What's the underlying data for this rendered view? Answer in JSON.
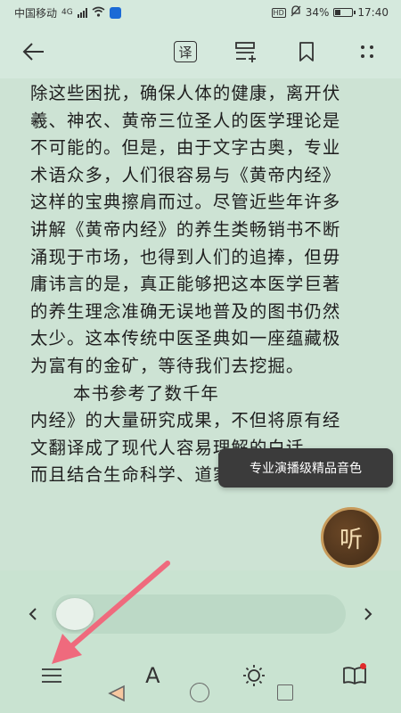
{
  "status_bar": {
    "carrier": "中国移动",
    "network": "4G",
    "battery_text": "34%",
    "battery_level": 0.34,
    "time": "17:40",
    "hd_label": "HD"
  },
  "toolbar": {
    "translate_label": "译"
  },
  "reader": {
    "lines": [
      "除这些困扰，确保人体的健康，离开伏",
      "羲、神农、黄帝三位圣人的医学理论是",
      "不可能的。但是，由于文字古奥，专业",
      "术语众多，人们很容易与《黄帝内经》",
      "这样的宝典擦肩而过。尽管近些年许多",
      "讲解《黄帝内经》的养生类畅销书不断",
      "涌现于市场，也得到人们的追捧，但毋",
      "庸讳言的是，真正能够把这本医学巨著",
      "的养生理念准确无误地普及的图书仍然",
      "太少。这本传统中医圣典如一座蕴藏极",
      "为富有的金矿，等待我们去挖掘。",
      "本书参考了数千年",
      "内经》的大量研究成果，不但将原有经",
      "文翻译成了现代人容易理解的白话",
      "而且结合生命科学、道家养生理论和中"
    ]
  },
  "tooltip": {
    "text": "专业演播级精品音色"
  },
  "listen_button": {
    "label": "听"
  },
  "bottom_bar": {
    "progress": 0.0,
    "font_label": "A"
  },
  "colors": {
    "page_background": "#cde3d4",
    "annotation_arrow": "#ef6a7d",
    "listen_ring": "#c79a5a"
  },
  "icons": {
    "back": "arrow-left-icon",
    "translate": "translate-icon",
    "add_bookmark_list": "add-list-icon",
    "bookmark": "bookmark-icon",
    "more": "more-dots-icon",
    "catalog": "menu-lines-icon",
    "font": "font-a-icon",
    "brightness": "sun-icon",
    "book": "open-book-icon"
  }
}
